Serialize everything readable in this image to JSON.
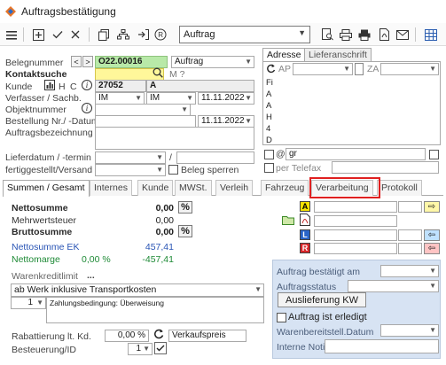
{
  "window": {
    "title": "Auftragsbestätigung"
  },
  "toolbar": {
    "doc_type_select": "Auftrag",
    "icons": [
      "menu-icon",
      "add-icon",
      "check-icon",
      "close-icon",
      "copy-icon",
      "hierarchy-icon",
      "import-icon",
      "refresh-r-icon",
      "search-document-icon",
      "print-preview-icon",
      "print-icon",
      "pdf-icon",
      "mail-icon",
      "table-icon"
    ]
  },
  "header": {
    "belegnummer_label": "Belegnummer",
    "belegnummer_value": "O22.00016",
    "belegtyp_value": "Auftrag",
    "kontaktsuche_label": "Kontaktsuche",
    "m_label": "M ?",
    "kunde_label": "Kunde",
    "kunde_h": "H",
    "kunde_c": "C",
    "kunde_nr": "27052",
    "kunde_name": "A",
    "verfasser_label": "Verfasser / Sachb.",
    "verfasser_value": "IM",
    "sachb_value": "IM",
    "datum1": "11.11.2022",
    "objektnummer_label": "Objektnummer",
    "bestellung_label": "Bestellung Nr./ -Datum",
    "datum2": "11.11.2022",
    "auftragsbezeichnung_label": "Auftragsbezeichnung",
    "lieferdatum_label": "Lieferdatum / -termin",
    "slash": "/",
    "fertiggestellt_label": "fertiggestellt/Versand",
    "beleg_sperren_label": "Beleg sperren"
  },
  "address": {
    "tabs": [
      "Adresse",
      "Lieferanschrift"
    ],
    "ap_label": "AP",
    "za_label": "ZA",
    "lines": [
      "Fi",
      "A",
      "A",
      "H",
      "4",
      "D"
    ],
    "email_value": "gr",
    "telefax_label": "per Telefax",
    "at_sign": "@"
  },
  "tabs": [
    "Summen / Gesamt",
    "Internes",
    "Kunde",
    "MWSt.",
    "Verleih",
    "Fahrzeug",
    "Verarbeitung",
    "Protokoll"
  ],
  "summary": {
    "netto_label": "Nettosumme",
    "netto_value": "0,00",
    "mwst_label": "Mehrwertsteuer",
    "mwst_value": "0,00",
    "brutto_label": "Bruttosumme",
    "brutto_value": "0,00",
    "pct_symbol": "%",
    "ek_label": "Nettosumme EK",
    "ek_value": "457,41",
    "marge_label": "Nettomarge",
    "marge_pct": "0,00 %",
    "marge_value": "-457,41",
    "kreditlimit_label": "Warenkreditlimit",
    "kreditlimit_dots": "...",
    "lieferbedingung": "ab Werk inklusive Transportkosten",
    "zahlung_nr": "1",
    "zahlung_text": "Zahlungsbedingung: Überweisung",
    "rabatt_label": "Rabattierung lt. Kd.",
    "rabatt_value": "0,00 %",
    "verkaufspreis_label": "Verkaufspreis",
    "besteuerung_label": "Besteuerung/ID",
    "besteuerung_value": "1"
  },
  "letters": [
    "A",
    "L",
    "R"
  ],
  "panel": {
    "bestaetigt_label": "Auftrag bestätigt am",
    "status_label": "Auftragsstatus",
    "auslieferung_button": "Auslieferung KW",
    "erledigt_label": "Auftrag ist erledigt",
    "warenbereit_label": "Warenbereitstell.Datum",
    "notiz_label": "Interne Notiz"
  }
}
